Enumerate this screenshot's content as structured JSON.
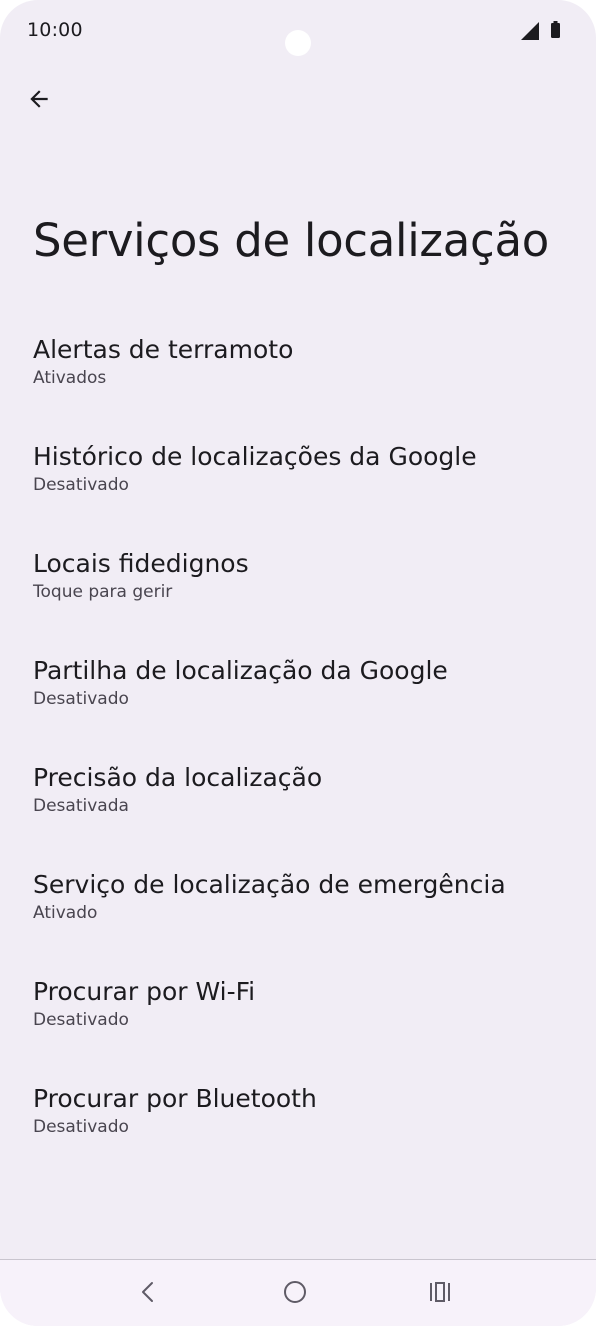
{
  "status_bar": {
    "time": "10:00",
    "icons": [
      "front-camera",
      "signal-icon",
      "battery-icon"
    ]
  },
  "header": {
    "back_icon": "arrow-left-icon"
  },
  "page": {
    "title": "Serviços de localização"
  },
  "items": [
    {
      "title": "Alertas de terramoto",
      "subtitle": "Ativados"
    },
    {
      "title": "Histórico de localizações da Google",
      "subtitle": "Desativado"
    },
    {
      "title": "Locais fidedignos",
      "subtitle": "Toque para gerir"
    },
    {
      "title": "Partilha de localização da Google",
      "subtitle": "Desativado"
    },
    {
      "title": "Precisão da localização",
      "subtitle": "Desativada"
    },
    {
      "title": "Serviço de localização de emergência",
      "subtitle": "Ativado"
    },
    {
      "title": "Procurar por Wi-Fi",
      "subtitle": "Desativado"
    },
    {
      "title": "Procurar por Bluetooth",
      "subtitle": "Desativado"
    }
  ],
  "nav_bar": {
    "icons": [
      "nav-back-icon",
      "nav-home-icon",
      "nav-recents-icon"
    ]
  },
  "colors": {
    "background": "#f1edf5",
    "text_primary": "#1c1b1f",
    "text_secondary": "#49454f",
    "nav_icon": "#5f5b66"
  }
}
